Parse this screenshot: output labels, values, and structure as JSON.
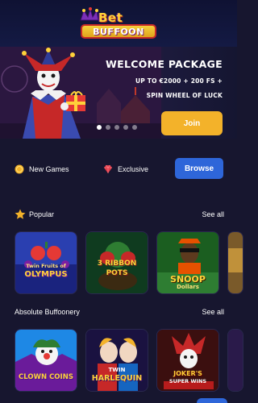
{
  "header": {
    "logo_top": "Bet",
    "logo_bottom": "BUFFOON"
  },
  "hero": {
    "title": "WELCOME PACKAGE",
    "subtitle_line1": "UP TO €2000 + 200 FS +",
    "subtitle_line2": "SPIN WHEEL OF LUCK",
    "join_label": "Join",
    "slide_count": 5,
    "active_slide": 1
  },
  "categories": {
    "new_games": "New Games",
    "exclusive": "Exclusive",
    "browse": "Browse"
  },
  "sections": [
    {
      "title": "Popular",
      "see_all": "See all",
      "games": [
        {
          "name_line1": "Twin Fruits of",
          "name_line2": "OLYMPUS"
        },
        {
          "name_line1": "3 RIBBON",
          "name_line2": "POTS"
        },
        {
          "name_line1": "SNOOP",
          "name_line2": "Dollars"
        }
      ]
    },
    {
      "title": "Absolute Buffoonery",
      "see_all": "See all",
      "games": [
        {
          "name_line1": "CLOWN COINS",
          "name_line2": ""
        },
        {
          "name_line1": "TWIN",
          "name_line2": "HARLEQUIN"
        },
        {
          "name_line1": "JOKER'S",
          "name_line2": "SUPER WINS"
        }
      ]
    }
  ],
  "colors": {
    "background": "#17162f",
    "accent_gold": "#f3b22a",
    "accent_blue": "#2e66d9"
  }
}
